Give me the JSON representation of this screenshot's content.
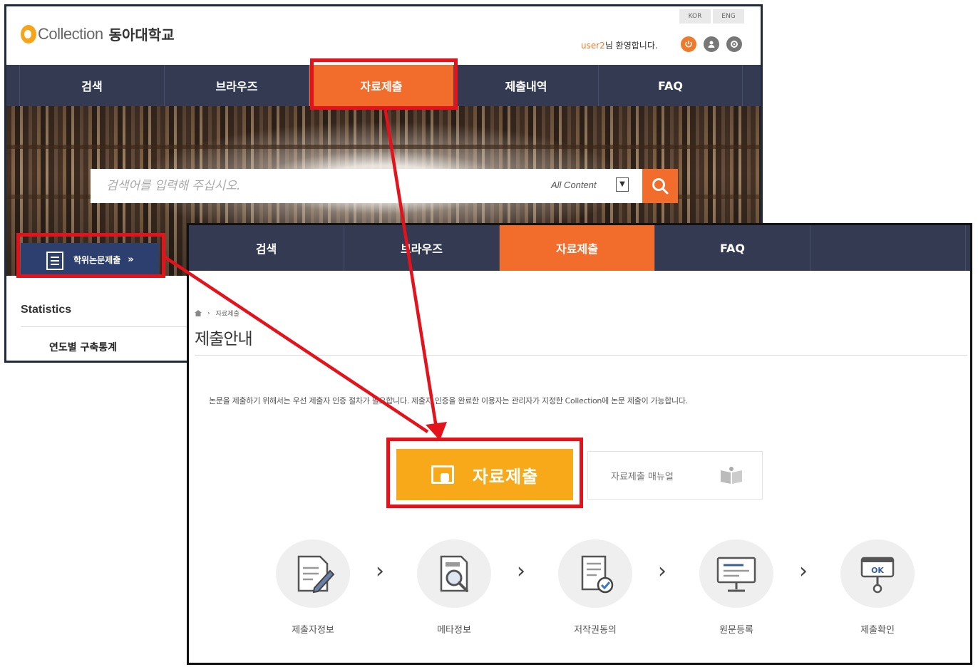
{
  "back_window": {
    "logo": {
      "brand": "Collection",
      "university": "동아대학교"
    },
    "lang": [
      "KOR",
      "ENG"
    ],
    "welcome": {
      "user": "user2",
      "suffix": "님 환영합니다."
    },
    "nav": [
      "검색",
      "브라우즈",
      "자료제출",
      "제출내역",
      "FAQ"
    ],
    "search": {
      "placeholder": "검색어를 입력해 주십시오.",
      "scope": "All Content"
    },
    "thesis_button": {
      "label": "학위논문제출",
      "chevron": "»"
    },
    "statistics": {
      "title": "Statistics",
      "item": "연도별 구축통계"
    }
  },
  "front_window": {
    "nav": [
      "검색",
      "브라우즈",
      "자료제출",
      "FAQ",
      ""
    ],
    "breadcrumb": [
      "자료제출"
    ],
    "page_title": "제출안내",
    "guide_text": "논문을 제출하기 위해서는 우선 제출자 인증 절차가 필요합니다. 제출자 인증을 완료한 이용자는 관리자가 지정한 Collection에 논문 제출이 가능합니다.",
    "submit_button": "자료제출",
    "manual_button": "자료제출 매뉴얼",
    "steps": [
      {
        "label": "제출자정보",
        "icon": "write-document-icon"
      },
      {
        "label": "메타정보",
        "icon": "search-document-icon"
      },
      {
        "label": "저작권동의",
        "icon": "approve-document-icon"
      },
      {
        "label": "원문등록",
        "icon": "monitor-upload-icon"
      },
      {
        "label": "제출확인",
        "icon": "ok-stamp-icon",
        "badge": "OK"
      }
    ],
    "step_arrow": "›"
  },
  "colors": {
    "nav": "#333a52",
    "accent": "#f26d2c",
    "submit": "#f8a919",
    "highlight": "#e3121b",
    "thesis": "#2d3f6e"
  }
}
